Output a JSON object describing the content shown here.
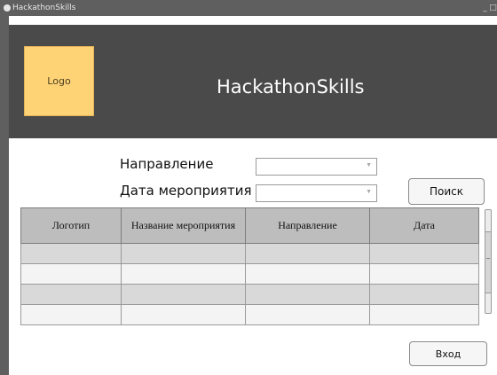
{
  "window": {
    "title": "HackathonSkills",
    "controls": [
      "_",
      "□"
    ]
  },
  "header": {
    "logo_text": "Logo",
    "app_title": "HackathonSkills"
  },
  "filters": {
    "direction_label": "Направление",
    "date_label": "Дата  мероприятия",
    "direction_value": "",
    "date_value": "",
    "search_button": "Поиск"
  },
  "table": {
    "columns": [
      "Логотип",
      "Название мероприятия",
      "Направление",
      "Дата"
    ],
    "rows": [
      [
        "",
        "",
        "",
        ""
      ],
      [
        "",
        "",
        "",
        ""
      ],
      [
        "",
        "",
        "",
        ""
      ],
      [
        "",
        "",
        "",
        ""
      ]
    ]
  },
  "login_button": "Вход",
  "colors": {
    "titlebar": "#5f5f5f",
    "header": "#4a4a4a",
    "logo_fill": "#fdd375",
    "table_header": "#bdbdbd",
    "row_dark": "#d9d9d9",
    "row_light": "#f4f4f4"
  }
}
